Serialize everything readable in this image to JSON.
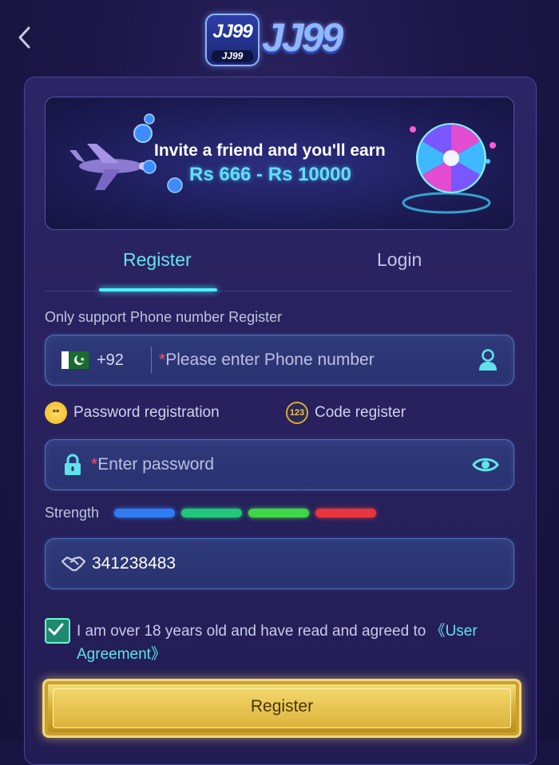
{
  "header": {
    "back_icon": "chevron-left-icon",
    "logo_badge_text": "JJ99",
    "logo_badge_subtext": "JJ99",
    "logo_text": "JJ99"
  },
  "banner": {
    "line1": "Invite a friend and you'll earn",
    "line2": "Rs 666 - Rs 10000"
  },
  "tabs": [
    {
      "label": "Register",
      "active": true
    },
    {
      "label": "Login",
      "active": false
    }
  ],
  "note": "Only support Phone number Register",
  "phone": {
    "country_code": "+92",
    "required_mark": "*",
    "placeholder": "Please enter Phone number"
  },
  "modes": {
    "password_icon_text": "**",
    "password_label": "Password registration",
    "code_icon_text": "123",
    "code_label": "Code register"
  },
  "password": {
    "required_mark": "*",
    "placeholder": "Enter password"
  },
  "strength": {
    "label": "Strength",
    "colors": [
      "#2f7cf0",
      "#22c77a",
      "#3fd64a",
      "#e8343e"
    ]
  },
  "invite_code": {
    "value": "341238483"
  },
  "agreement": {
    "checked": true,
    "text": "I am over 18 years old and have read and agreed to ",
    "link": "《User Agreement》"
  },
  "register_button": "Register",
  "colors": {
    "accent": "#4ff0ff",
    "gold": "#d9b23a"
  }
}
